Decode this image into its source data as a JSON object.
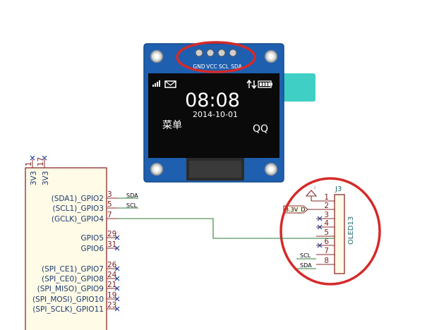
{
  "oled_module": {
    "header_pins": [
      "GND",
      "VCC",
      "SCL",
      "SDA"
    ],
    "clock": "08:08",
    "date": "2014-10-01",
    "left_label": "菜单",
    "right_label": "QQ"
  },
  "mcu": {
    "power_pins": [
      "3V3",
      "3V3"
    ],
    "power_pin_numbers": [
      "1",
      "17"
    ],
    "pins": [
      {
        "label": "(SDA1)_GPIO2",
        "number": "3",
        "net": "SDA"
      },
      {
        "label": "(SCL1)_GPIO3",
        "number": "5",
        "net": "SCL"
      },
      {
        "label": "(GCLK)_GPIO4",
        "number": "7",
        "net": ""
      },
      {
        "label": "GPIO5",
        "number": "29",
        "net": ""
      },
      {
        "label": "GPIO6",
        "number": "31",
        "net": ""
      },
      {
        "label": "(SPI_CE1)_GPIO7",
        "number": "26",
        "net": ""
      },
      {
        "label": "(SPI_CE0)_GPIO8",
        "number": "24",
        "net": ""
      },
      {
        "label": "(SPI_MISO)_GPIO9",
        "number": "21",
        "net": ""
      },
      {
        "label": "(SPI_MOSI)_GPIO10",
        "number": "19",
        "net": ""
      },
      {
        "label": "(SPI_SCLK)_GPIO11",
        "number": "23",
        "net": ""
      }
    ]
  },
  "connector": {
    "ref": "J3",
    "value": "OLED13",
    "pin_numbers": [
      "1",
      "2",
      "3",
      "4",
      "5",
      "6",
      "7",
      "8"
    ],
    "power_label": "3.3V_D",
    "net_labels": {
      "scl": "SCL",
      "sda": "SDA"
    }
  },
  "colors": {
    "highlight": "#d42a2a",
    "wire": "#2e7d32",
    "body_fill": "#fffbe6",
    "body_stroke": "#8b2a2a",
    "pcb": "#1f5fb0",
    "screen": "#0a0a0a",
    "ribbon": "#3fcfc4"
  }
}
